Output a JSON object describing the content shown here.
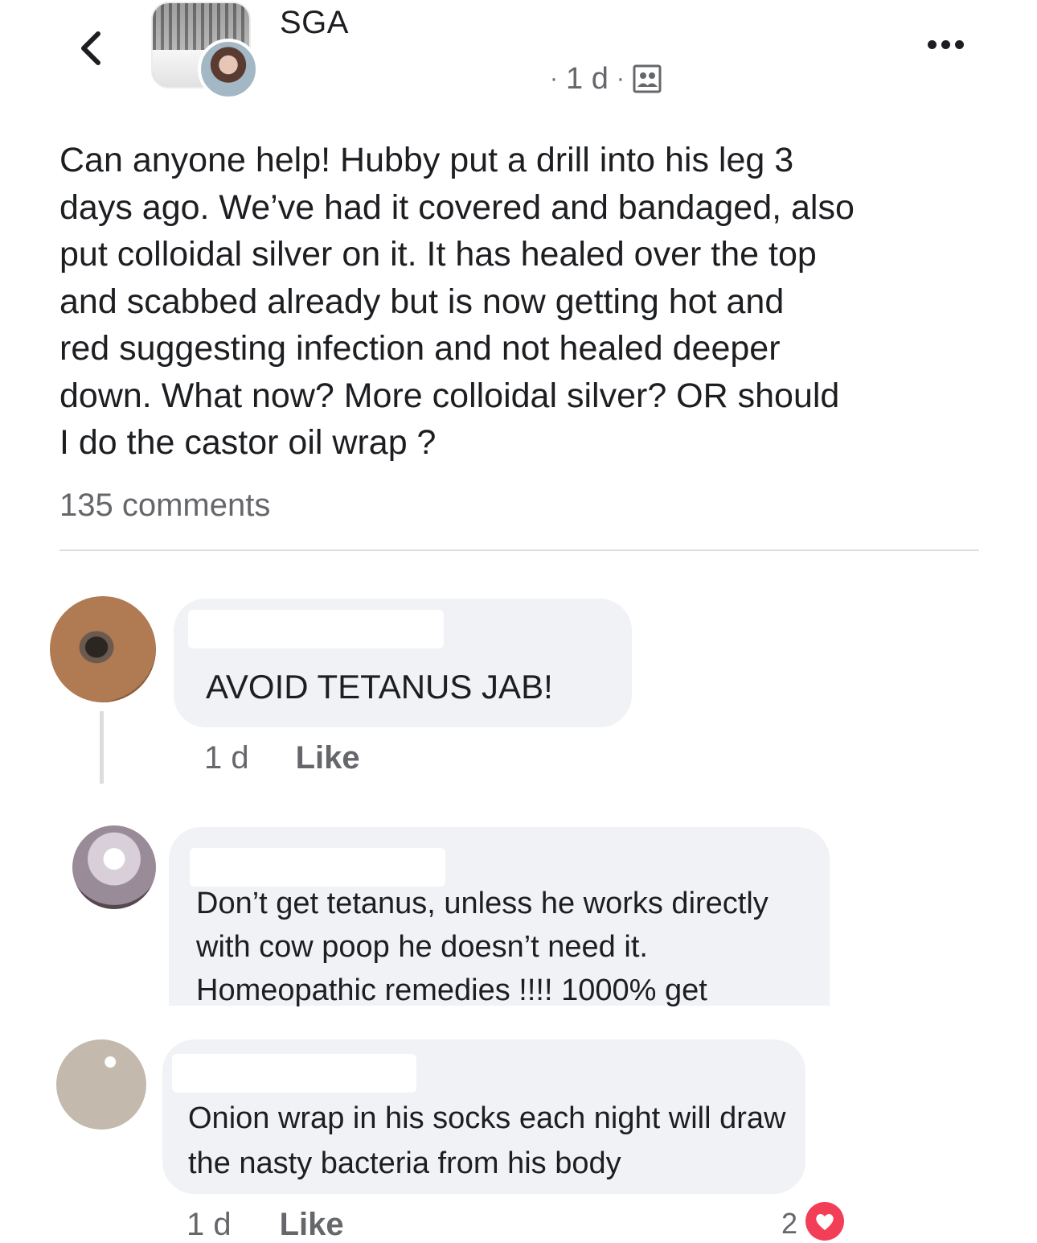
{
  "header": {
    "group_name": "SGA",
    "post_age": "1 d",
    "back_icon": "chevron-left-icon",
    "more_icon": "more-horizontal-icon",
    "audience_icon": "group-members-icon"
  },
  "post": {
    "text": "Can anyone help! Hubby put a drill into his leg 3\ndays ago. We’ve had it covered and bandaged, also\nput colloidal silver on it. It has healed over the top\nand scabbed already but is now getting hot and\nred suggesting infection and not healed deeper\ndown. What now? More colloidal silver? OR should\nI do the castor oil wrap ?",
    "comment_count": "135 comments"
  },
  "comments": [
    {
      "text": "AVOID TETANUS JAB!",
      "time": "1 d",
      "like_label": "Like"
    },
    {
      "text": "Don’t get tetanus, unless he works directly with cow poop he doesn’t need it. Homeopathic remedies !!!! 1000% get"
    },
    {
      "text": "Onion wrap in his socks each night will draw the nasty bacteria from his body",
      "time": "1 d",
      "like_label": "Like",
      "reaction_count": "2",
      "reaction_icon": "love-reaction-icon"
    }
  ],
  "colors": {
    "text_primary": "#1c1e21",
    "text_secondary": "#65676b",
    "bubble_bg": "#f0f2f5",
    "divider": "#dadde1",
    "love_reaction": "#f33e58"
  }
}
